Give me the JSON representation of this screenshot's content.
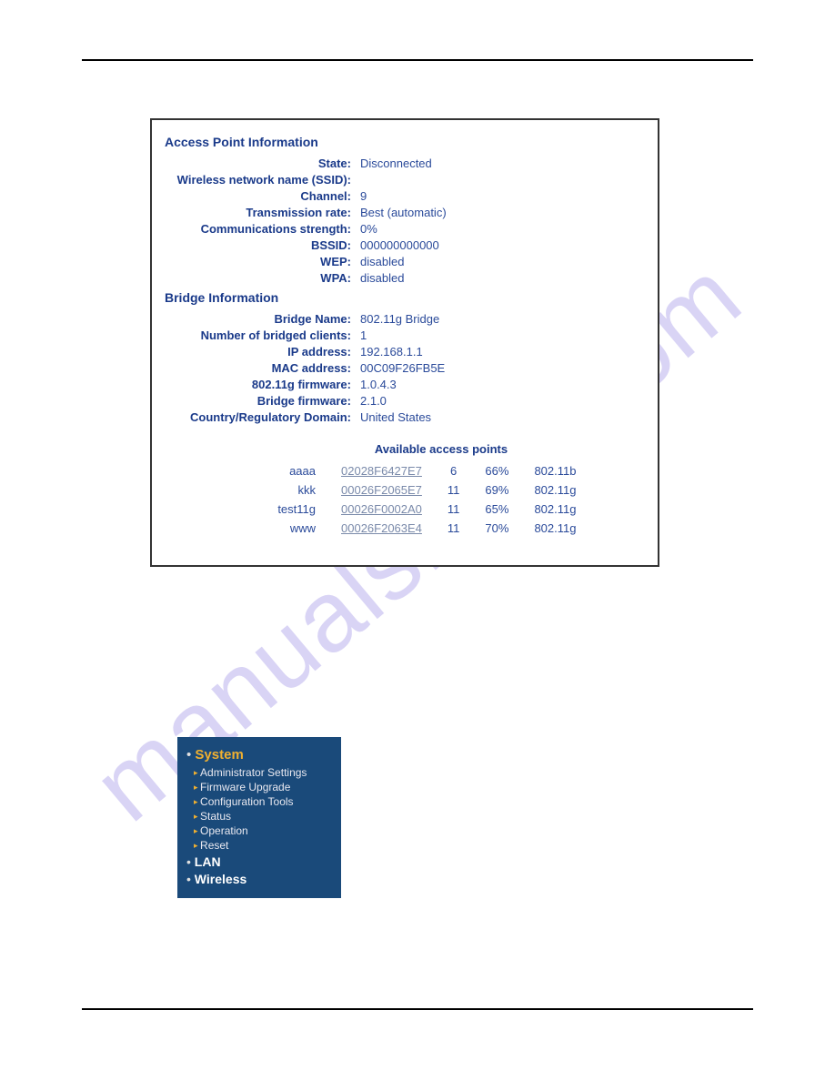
{
  "ap_info": {
    "title": "Access Point Information",
    "rows": [
      {
        "label": "State:",
        "value": "Disconnected"
      },
      {
        "label": "Wireless network name (SSID):",
        "value": ""
      },
      {
        "label": "Channel:",
        "value": "9"
      },
      {
        "label": "Transmission rate:",
        "value": "Best (automatic)"
      },
      {
        "label": "Communications strength:",
        "value": "0%"
      },
      {
        "label": "BSSID:",
        "value": "000000000000"
      },
      {
        "label": "WEP:",
        "value": "disabled"
      },
      {
        "label": "WPA:",
        "value": "disabled"
      }
    ]
  },
  "bridge_info": {
    "title": "Bridge Information",
    "rows": [
      {
        "label": "Bridge Name:",
        "value": "802.11g Bridge"
      },
      {
        "label": "Number of bridged clients:",
        "value": "1"
      },
      {
        "label": "IP address:",
        "value": "192.168.1.1"
      },
      {
        "label": "MAC address:",
        "value": "00C09F26FB5E"
      },
      {
        "label": "802.11g firmware:",
        "value": "1.0.4.3"
      },
      {
        "label": "Bridge firmware:",
        "value": "2.1.0"
      },
      {
        "label": "Country/Regulatory Domain:",
        "value": "United States"
      }
    ]
  },
  "available_aps": {
    "title": "Available access points",
    "rows": [
      {
        "name": "aaaa",
        "bssid": "02028F6427E7",
        "channel": "6",
        "strength": "66%",
        "mode": "802.11b"
      },
      {
        "name": "kkk",
        "bssid": "00026F2065E7",
        "channel": "11",
        "strength": "69%",
        "mode": "802.11g"
      },
      {
        "name": "test11g",
        "bssid": "00026F0002A0",
        "channel": "11",
        "strength": "65%",
        "mode": "802.11g"
      },
      {
        "name": "www",
        "bssid": "00026F2063E4",
        "channel": "11",
        "strength": "70%",
        "mode": "802.11g"
      }
    ]
  },
  "nav": {
    "system": {
      "label": "System",
      "items": [
        "Administrator Settings",
        "Firmware Upgrade",
        "Configuration Tools",
        "Status",
        "Operation",
        "Reset"
      ]
    },
    "lan": {
      "label": "LAN"
    },
    "wireless": {
      "label": "Wireless"
    }
  },
  "watermark": "manualsnive.com"
}
